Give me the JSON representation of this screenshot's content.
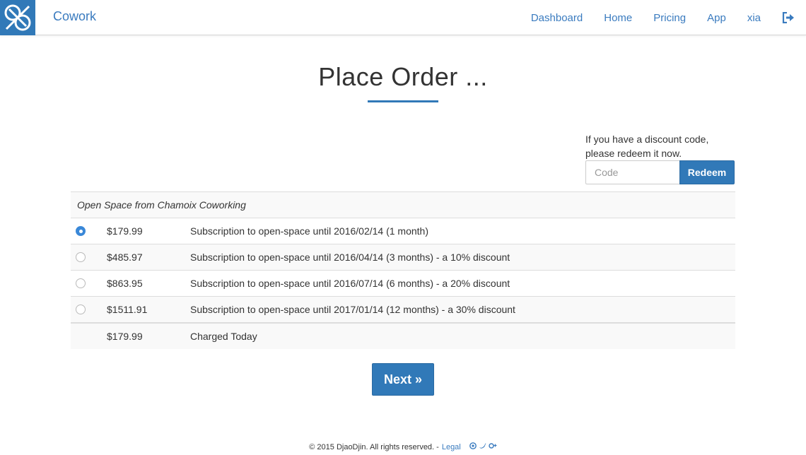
{
  "nav": {
    "brand": "Cowork",
    "links": [
      "Dashboard",
      "Home",
      "Pricing",
      "App"
    ],
    "user": "xia"
  },
  "page": {
    "title": "Place Order ..."
  },
  "discount": {
    "text_line1": "If you have a discount code,",
    "text_line2": "please redeem it now.",
    "placeholder": "Code",
    "redeem_label": "Redeem"
  },
  "order": {
    "header": "Open Space from Chamoix Coworking",
    "options": [
      {
        "price": "$179.99",
        "description": "Subscription to open-space until 2016/02/14 (1 month)",
        "selected": true
      },
      {
        "price": "$485.97",
        "description": "Subscription to open-space until 2016/04/14 (3 months) - a 10% discount",
        "selected": false
      },
      {
        "price": "$863.95",
        "description": "Subscription to open-space until 2016/07/14 (6 months) - a 20% discount",
        "selected": false
      },
      {
        "price": "$1511.91",
        "description": "Subscription to open-space until 2017/01/14 (12 months) - a 30% discount",
        "selected": false
      }
    ],
    "total_price": "$179.99",
    "total_label": "Charged Today"
  },
  "next_label": "Next »",
  "footer": {
    "copyright": "© 2015 DjaoDjin. All rights reserved. -",
    "legal": "Legal"
  },
  "icons": {
    "logo": "cowork-logo-icon",
    "signout": "sign-out-icon",
    "github": "github-icon",
    "twitter": "twitter-icon",
    "google_plus": "google-plus-icon"
  },
  "colors": {
    "accent": "#3179b8",
    "link": "#3a7bbf",
    "radio_selected": "#3a88d8"
  }
}
